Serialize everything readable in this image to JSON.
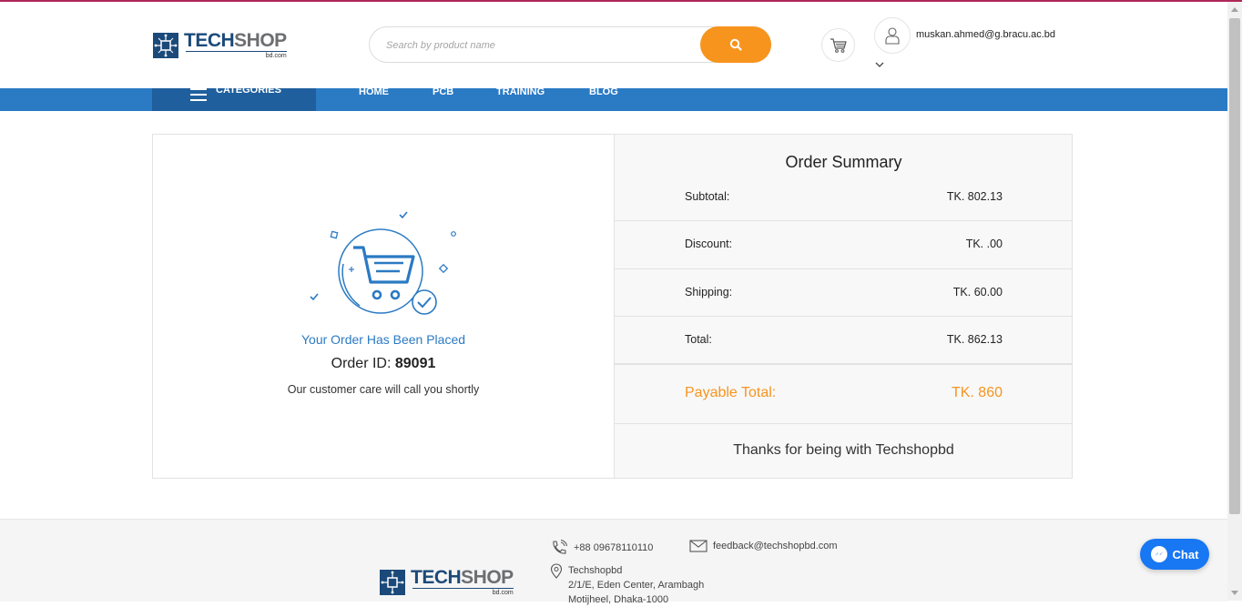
{
  "header": {
    "logo": {
      "main_left": "TECH",
      "main_right": "SHOP",
      "sub": "bd.com"
    },
    "search": {
      "placeholder": "Search by product name"
    },
    "user": {
      "email": "muskan.ahmed@g.bracu.ac.bd"
    }
  },
  "nav": {
    "categories_label": "CATEGORIES",
    "items": [
      "HOME",
      "PCB",
      "TRAINING",
      "BLOG"
    ]
  },
  "order": {
    "placed_text": "Your Order Has Been Placed",
    "id_label": "Order ID:",
    "id_value": "89091",
    "care_text": "Our customer care will call you shortly"
  },
  "summary": {
    "title": "Order Summary",
    "rows": [
      {
        "label": "Subtotal:",
        "value": "TK. 802.13"
      },
      {
        "label": "Discount:",
        "value": "TK. .00"
      },
      {
        "label": "Shipping:",
        "value": "TK. 60.00"
      },
      {
        "label": "Total:",
        "value": "TK. 862.13"
      }
    ],
    "payable": {
      "label": "Payable Total:",
      "value": "TK. 860"
    },
    "thanks": "Thanks for being with Techshopbd"
  },
  "footer": {
    "phone": "+88 09678110110",
    "email": "feedback@techshopbd.com",
    "address_lines": [
      "Techshopbd",
      "2/1/E, Eden Center, Arambagh",
      "Motijheel, Dhaka-1000"
    ]
  },
  "chat": {
    "label": "Chat"
  },
  "colors": {
    "primary": "#2b7ac4",
    "accent": "#f7941d",
    "nav_dark": "#1f5f9e",
    "brand": "#1b4a7a"
  }
}
